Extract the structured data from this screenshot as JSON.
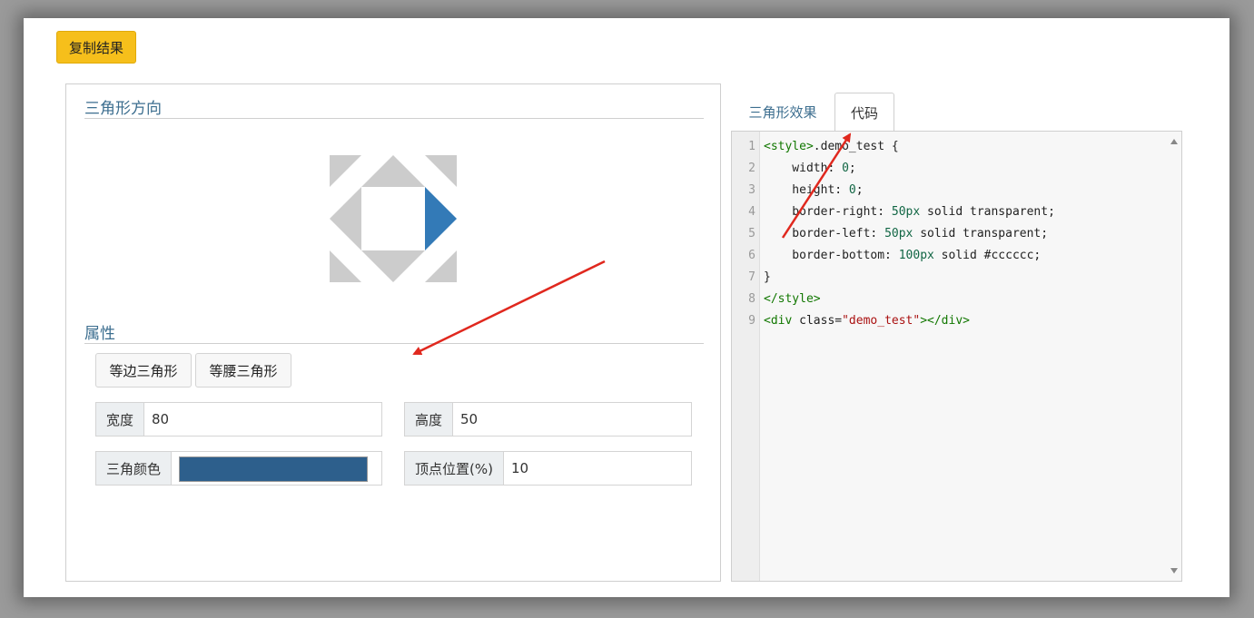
{
  "toolbar": {
    "copy_label": "复制结果"
  },
  "left": {
    "direction_title": "三角形方向",
    "props_title": "属性",
    "buttons": {
      "equilateral": "等边三角形",
      "isosceles": "等腰三角形"
    },
    "fields": {
      "width_label": "宽度",
      "width_value": "80",
      "height_label": "高度",
      "height_value": "50",
      "color_label": "三角颜色",
      "color_value": "#2d5f8c",
      "vertex_label": "顶点位置(%)",
      "vertex_value": "10"
    },
    "selected_direction": "right",
    "colors": {
      "selected": "#337ab7",
      "unselected": "#cccccc"
    }
  },
  "tabs": [
    {
      "label": "三角形效果",
      "active": false
    },
    {
      "label": "代码",
      "active": true
    }
  ],
  "code": {
    "line_numbers": [
      "1",
      "2",
      "3",
      "4",
      "5",
      "6",
      "7",
      "8",
      "9"
    ],
    "lines": [
      "<style>.demo_test {",
      "    width: 0;",
      "    height: 0;",
      "    border-right: 50px solid transparent;",
      "    border-left: 50px solid transparent;",
      "    border-bottom: 100px solid #cccccc;",
      "}",
      "</style>",
      "<div class=\"demo_test\"></div>"
    ]
  },
  "annotation_color": "#e0281e"
}
